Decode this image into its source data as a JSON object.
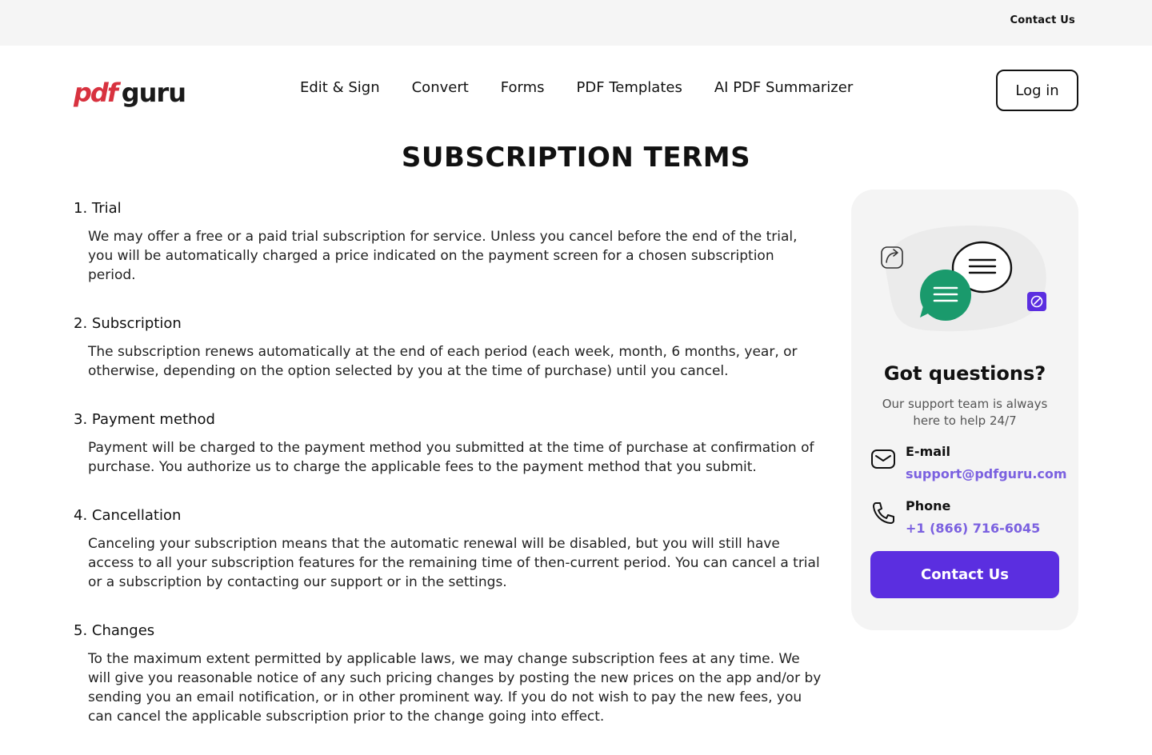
{
  "topbar": {
    "contact_link": "Contact Us"
  },
  "logo": {
    "part1": "pdf",
    "part2": "guru"
  },
  "nav": {
    "items": [
      "Edit & Sign",
      "Convert",
      "Forms",
      "PDF Templates",
      "AI PDF Summarizer"
    ],
    "login": "Log in"
  },
  "page": {
    "title": "SUBSCRIPTION TERMS"
  },
  "terms": [
    {
      "title": "1. Trial",
      "body": "We may offer a free or a paid trial subscription for service. Unless you cancel before the end of the trial, you will be automatically charged a price indicated on the payment screen for a chosen subscription period."
    },
    {
      "title": "2. Subscription",
      "body": "The subscription renews automatically at the end of each period (each week, month, 6 months, year, or otherwise, depending on the option selected by you at the time of purchase) until you cancel."
    },
    {
      "title": "3. Payment method",
      "body": "Payment will be charged to the payment method you submitted at the time of purchase at confirmation of purchase. You authorize us to charge the applicable fees to the payment method that you submit."
    },
    {
      "title": "4. Cancellation",
      "body": "Canceling your subscription means that the automatic renewal will be disabled, but you will still have access to all your subscription features for the remaining time of then-current period. You can cancel a trial or a subscription by contacting our support or in the settings."
    },
    {
      "title": "5. Changes",
      "body": "To the maximum extent permitted by applicable laws, we may change subscription fees at any time. We will give you reasonable notice of any such pricing changes by posting the new prices on the app and/or by sending you an email notification, or in other prominent way. If you do not wish to pay the new fees, you can cancel the applicable subscription prior to the change going into effect."
    }
  ],
  "support": {
    "title": "Got questions?",
    "subtitle": "Our support team is always here to help 24/7",
    "email_label": "E-mail",
    "email": "support@pdfguru.com",
    "phone_label": "Phone",
    "phone": "+1 (866) 716-6045",
    "button": "Contact Us"
  },
  "colors": {
    "brand_red": "#d8323f",
    "accent_purple": "#5b2ee0",
    "link_purple": "#7b61e0",
    "chat_green": "#1a9a6c"
  }
}
